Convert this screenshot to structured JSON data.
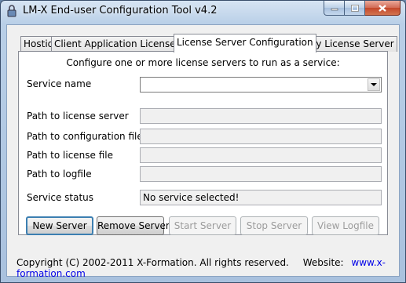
{
  "window": {
    "title": "LM-X End-user Configuration Tool v4.2"
  },
  "tabs": [
    {
      "label": "Hostid"
    },
    {
      "label": "Client Application License Path"
    },
    {
      "label": "License Server Configuration"
    },
    {
      "label": "Query License Server"
    }
  ],
  "panel": {
    "title": "Configure one or more license servers to run as a service:",
    "service_name_label": "Service name",
    "service_name_value": "",
    "path_server_label": "Path to license server",
    "path_config_label": "Path to configuration file",
    "path_license_label": "Path to license file",
    "path_logfile_label": "Path to logfile",
    "status_label": "Service status",
    "status_value": "No service selected!"
  },
  "buttons": {
    "new_server": "New Server",
    "remove_server": "Remove Server",
    "start_server": "Start Server",
    "stop_server": "Stop Server",
    "view_logfile": "View Logfile"
  },
  "footer": {
    "copyright": "Copyright (C) 2002-2011 X-Formation. All rights reserved.",
    "website_label": "Website:",
    "website_link": "www.x-formation.com"
  },
  "colors": {
    "link": "#0000e8",
    "title_bar": "#b9cfe7",
    "client": "#f0f0f0"
  }
}
